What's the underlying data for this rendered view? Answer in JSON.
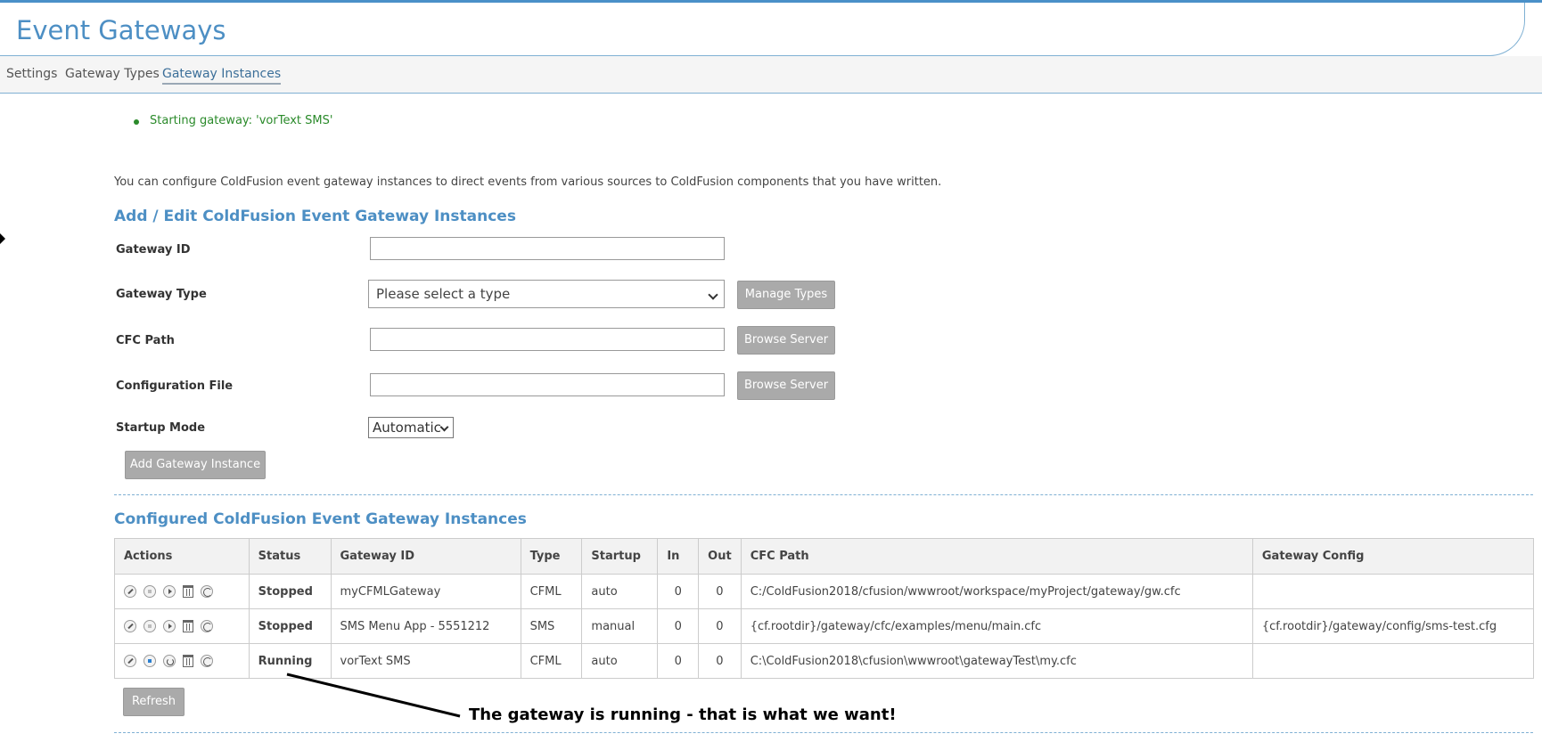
{
  "header": {
    "title": "Event Gateways"
  },
  "tabs": [
    {
      "label": "Settings",
      "active": false
    },
    {
      "label": "Gateway Types",
      "active": false
    },
    {
      "label": "Gateway Instances",
      "active": true
    }
  ],
  "messages": [
    "Starting gateway: 'vorText SMS'"
  ],
  "intro": "You can configure ColdFusion event gateway instances to direct events from various sources to ColdFusion components that you have written.",
  "form": {
    "title": "Add / Edit ColdFusion Event Gateway Instances",
    "gateway_id_label": "Gateway ID",
    "gateway_id_value": "",
    "gateway_type_label": "Gateway Type",
    "gateway_type_value": "Please select a type",
    "manage_types_label": "Manage Types",
    "cfc_path_label": "CFC Path",
    "cfc_path_value": "",
    "browse_label": "Browse Server",
    "config_file_label": "Configuration File",
    "config_file_value": "",
    "startup_mode_label": "Startup Mode",
    "startup_mode_value": "Automatic",
    "add_button_label": "Add Gateway Instance"
  },
  "instances": {
    "title": "Configured ColdFusion Event Gateway Instances",
    "columns": [
      "Actions",
      "Status",
      "Gateway ID",
      "Type",
      "Startup",
      "In",
      "Out",
      "CFC Path",
      "Gateway Config"
    ],
    "rows": [
      {
        "status": "Stopped",
        "gateway_id": "myCFMLGateway",
        "type": "CFML",
        "startup": "auto",
        "in": "0",
        "out": "0",
        "cfc_path": "C:/ColdFusion2018/cfusion/wwwroot/workspace/myProject/gateway/gw.cfc",
        "config": ""
      },
      {
        "status": "Stopped",
        "gateway_id": "SMS Menu App - 5551212",
        "type": "SMS",
        "startup": "manual",
        "in": "0",
        "out": "0",
        "cfc_path": "{cf.rootdir}/gateway/cfc/examples/menu/main.cfc",
        "config": "{cf.rootdir}/gateway/config/sms-test.cfg"
      },
      {
        "status": "Running",
        "gateway_id": "vorText SMS",
        "type": "CFML",
        "startup": "auto",
        "in": "0",
        "out": "0",
        "cfc_path": "C:\\ColdFusion2018\\cfusion\\wwwroot\\gatewayTest\\my.cfc",
        "config": ""
      }
    ],
    "refresh_label": "Refresh"
  },
  "annotation": "The gateway is running - that is what we want!",
  "colors": {
    "accent": "#4d8fc4",
    "success": "#2a8a2a",
    "button": "#aaaaaa"
  }
}
